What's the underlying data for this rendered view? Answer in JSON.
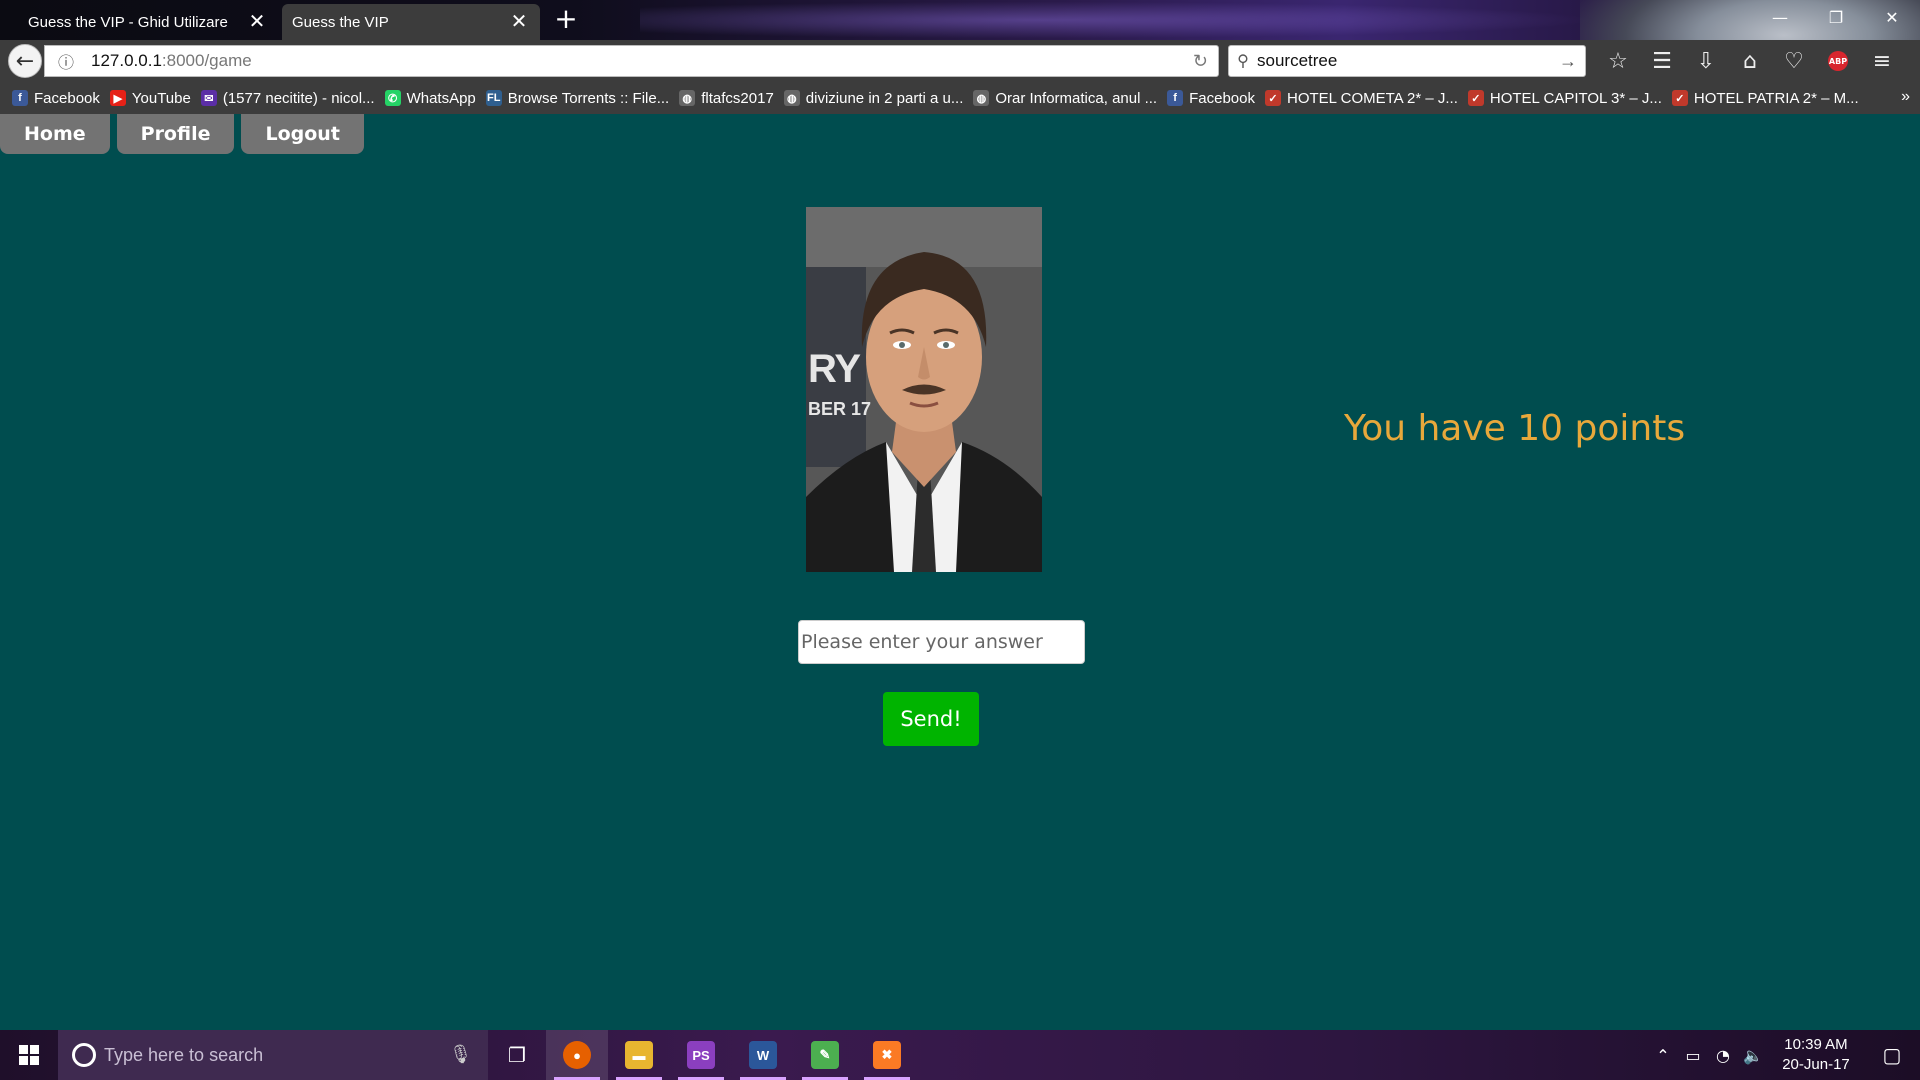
{
  "browser": {
    "tabs": [
      {
        "title": "Guess the VIP - Ghid Utilizare",
        "active": false
      },
      {
        "title": "Guess the VIP",
        "active": true
      }
    ],
    "url_host": "127.0.0.1",
    "url_path": ":8000/game",
    "search_value": "sourcetree",
    "bookmarks": [
      {
        "label": "Facebook",
        "icon": "facebook-icon",
        "color": "#3b5998",
        "glyph": "f"
      },
      {
        "label": "YouTube",
        "icon": "youtube-icon",
        "color": "#e62117",
        "glyph": "▶"
      },
      {
        "label": "(1577 necitite) - nicol...",
        "icon": "mail-icon",
        "color": "#5b2ea6",
        "glyph": "✉"
      },
      {
        "label": "WhatsApp",
        "icon": "whatsapp-icon",
        "color": "#25d366",
        "glyph": "✆"
      },
      {
        "label": "Browse Torrents :: File...",
        "icon": "torrent-icon",
        "color": "#2f5f8f",
        "glyph": "FL"
      },
      {
        "label": "fltafcs2017",
        "icon": "globe-icon",
        "color": "#666666",
        "glyph": "◍"
      },
      {
        "label": "diviziune in 2 parti a u...",
        "icon": "globe-icon",
        "color": "#666666",
        "glyph": "◍"
      },
      {
        "label": "Orar Informatica, anul ...",
        "icon": "globe-icon",
        "color": "#666666",
        "glyph": "◍"
      },
      {
        "label": "Facebook",
        "icon": "facebook-icon",
        "color": "#3b5998",
        "glyph": "f"
      },
      {
        "label": "HOTEL COMETA 2* – J...",
        "icon": "hotel-icon",
        "color": "#c0392b",
        "glyph": "✓"
      },
      {
        "label": "HOTEL CAPITOL 3* – J...",
        "icon": "hotel-icon",
        "color": "#c0392b",
        "glyph": "✓"
      },
      {
        "label": "HOTEL PATRIA 2* – M...",
        "icon": "hotel-icon",
        "color": "#c0392b",
        "glyph": "✓"
      }
    ]
  },
  "site": {
    "nav": [
      "Home",
      "Profile",
      "Logout"
    ],
    "photo_banner": "RY",
    "photo_banner_sub": "BER 17",
    "points_text": "You have 10 points",
    "answer_placeholder": "Please enter your answer",
    "send_label": "Send!"
  },
  "taskbar": {
    "search_placeholder": "Type here to search",
    "apps": [
      {
        "name": "firefox",
        "color": "#e66000",
        "glyph": "●",
        "active": true
      },
      {
        "name": "file-explorer",
        "color": "#e8b530",
        "glyph": "▬",
        "active": false
      },
      {
        "name": "phpstorm",
        "color": "#8b3fbf",
        "glyph": "PS",
        "active": false
      },
      {
        "name": "word",
        "color": "#2b579a",
        "glyph": "W",
        "active": false
      },
      {
        "name": "notepad",
        "color": "#4caf50",
        "glyph": "✎",
        "active": false
      },
      {
        "name": "xampp",
        "color": "#fb7a24",
        "glyph": "✖",
        "active": false
      }
    ],
    "time": "10:39 AM",
    "date": "20-Jun-17"
  },
  "colors": {
    "page_bg": "#004d4f",
    "points": "#e8a83b",
    "send_button": "#00b400",
    "nav_button": "#737373"
  }
}
